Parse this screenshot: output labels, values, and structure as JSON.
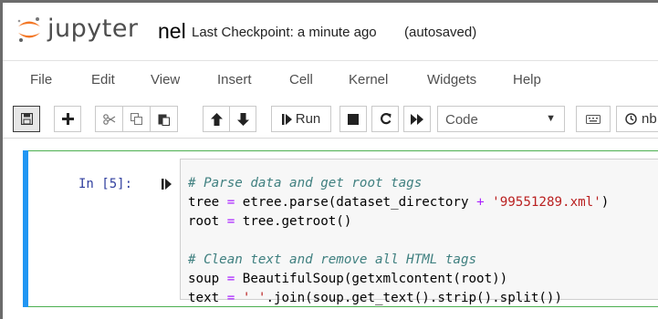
{
  "header": {
    "logo_text": "jupyter",
    "notebook_name": "nel",
    "checkpoint": "Last Checkpoint: a minute ago",
    "autosave": "(autosaved)"
  },
  "menu": {
    "items": [
      {
        "label": "File"
      },
      {
        "label": "Edit"
      },
      {
        "label": "View"
      },
      {
        "label": "Insert"
      },
      {
        "label": "Cell"
      },
      {
        "label": "Kernel"
      },
      {
        "label": "Widgets"
      },
      {
        "label": "Help"
      }
    ]
  },
  "toolbar": {
    "run_label": "Run",
    "cell_type": "Code",
    "nb_label": "nb"
  },
  "cell": {
    "prompt": "In [5]:",
    "code": [
      {
        "kind": "comment",
        "text": "# Parse data and get root tags"
      },
      {
        "kind": "code",
        "parts": [
          {
            "t": "tree "
          },
          {
            "t": "=",
            "c": "op"
          },
          {
            "t": " etree.parse(dataset_directory "
          },
          {
            "t": "+",
            "c": "op"
          },
          {
            "t": " "
          },
          {
            "t": "'99551289.xml'",
            "c": "str"
          },
          {
            "t": ")"
          }
        ]
      },
      {
        "kind": "code",
        "parts": [
          {
            "t": "root "
          },
          {
            "t": "=",
            "c": "op"
          },
          {
            "t": " tree.getroot()"
          }
        ]
      },
      {
        "kind": "blank"
      },
      {
        "kind": "comment",
        "text": "# Clean text and remove all HTML tags"
      },
      {
        "kind": "code",
        "parts": [
          {
            "t": "soup "
          },
          {
            "t": "=",
            "c": "op"
          },
          {
            "t": " BeautifulSoup(getxmlcontent(root))"
          }
        ]
      },
      {
        "kind": "code",
        "parts": [
          {
            "t": "text "
          },
          {
            "t": "=",
            "c": "op"
          },
          {
            "t": " "
          },
          {
            "t": "' '",
            "c": "str"
          },
          {
            "t": ".join(soup.get_text().strip().split())"
          }
        ]
      }
    ]
  },
  "colors": {
    "accent_orange": "#f37726",
    "cell_selected_border": "#4caf50",
    "cell_left_bar": "#2196f3",
    "prompt": "#303f9f",
    "comment": "#408080",
    "operator": "#aa22ff",
    "string": "#ba2121"
  }
}
